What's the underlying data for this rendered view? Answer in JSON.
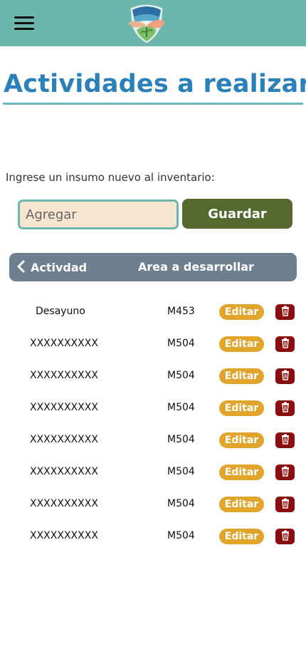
{
  "header": {
    "menu_icon": "hamburger-menu-icon",
    "logo_icon": "hands-plant-logo-icon",
    "colors": {
      "bar": "#6cb7ad"
    }
  },
  "page": {
    "title": "Actividades a realizar",
    "prompt": "Ingrese un insumo nuevo al inventario:",
    "colors": {
      "title": "#2a80b9"
    }
  },
  "form": {
    "input_placeholder": "Agregar",
    "input_value": "",
    "save_label": "Guardar",
    "colors": {
      "input_bg": "#f6e6d0",
      "save_bg": "#55692f"
    }
  },
  "table": {
    "back_icon": "chevron-left-icon",
    "col_activity": "Activdad",
    "col_area": "Area a desarrollar",
    "edit_label": "Editar",
    "delete_icon": "trash-icon",
    "colors": {
      "header_bg": "#6e7f8f",
      "edit_bg": "#e0a52a",
      "delete_bg": "#8b0d0d"
    },
    "rows": [
      {
        "name": "Desayuno",
        "code": "M453"
      },
      {
        "name": "XXXXXXXXXX",
        "code": "M504"
      },
      {
        "name": "XXXXXXXXXX",
        "code": "M504"
      },
      {
        "name": "XXXXXXXXXX",
        "code": "M504"
      },
      {
        "name": "XXXXXXXXXX",
        "code": "M504"
      },
      {
        "name": "XXXXXXXXXX",
        "code": "M504"
      },
      {
        "name": "XXXXXXXXXX",
        "code": "M504"
      },
      {
        "name": "XXXXXXXXXX",
        "code": "M504"
      }
    ]
  }
}
